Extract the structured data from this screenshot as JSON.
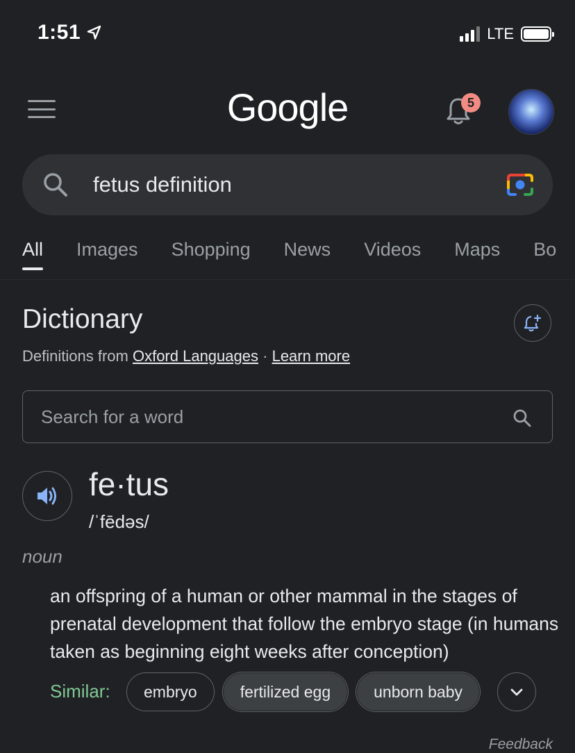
{
  "status_bar": {
    "time": "1:51",
    "network": "LTE"
  },
  "header": {
    "logo": "Google",
    "notification_count": "5"
  },
  "search": {
    "query": "fetus definition"
  },
  "tabs": [
    {
      "label": "All",
      "active": true
    },
    {
      "label": "Images"
    },
    {
      "label": "Shopping"
    },
    {
      "label": "News"
    },
    {
      "label": "Videos"
    },
    {
      "label": "Maps"
    },
    {
      "label": "Bo"
    }
  ],
  "dictionary": {
    "title": "Dictionary",
    "source_prefix": "Definitions from",
    "source_link": "Oxford Languages",
    "separator": "·",
    "learn_more": "Learn more",
    "search_placeholder": "Search for a word",
    "word": "fe·tus",
    "phonetic": "/ˈfēdəs/",
    "part_of_speech": "noun",
    "definition": "an offspring of a human or other mammal in the stages of prenatal development that follow the embryo stage (in humans taken as beginning eight weeks after conception)",
    "similar_label": "Similar:",
    "similar": [
      "embryo",
      "fertilized egg",
      "unborn baby"
    ],
    "feedback": "Feedback"
  },
  "icons": {
    "menu": "menu-icon",
    "location": "location-arrow-icon",
    "bell": "bell-icon",
    "search": "search-icon",
    "camera": "google-lens-icon",
    "alert": "add-alert-icon",
    "speaker": "speaker-icon",
    "expand": "chevron-down-icon"
  },
  "colors": {
    "background": "#202124",
    "searchbar": "#303134",
    "accent_blue": "#8ab4f8",
    "similar_green": "#81c995",
    "badge": "#f28b82"
  }
}
